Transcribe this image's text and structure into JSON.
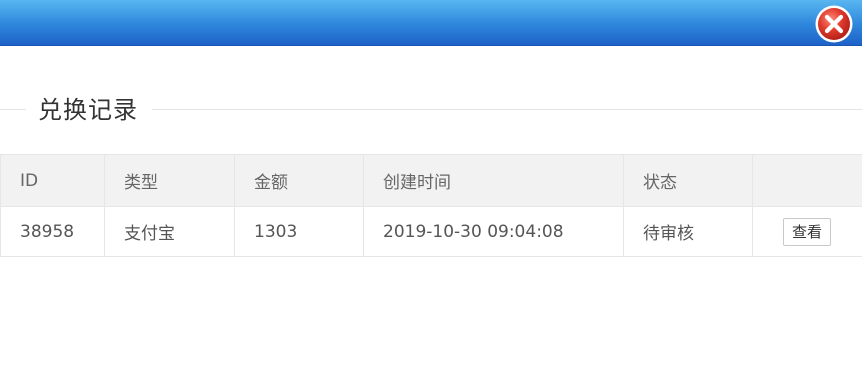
{
  "dialog": {
    "close_icon": "close-icon",
    "close_color": "#d9322b"
  },
  "section": {
    "title": "兑换记录"
  },
  "table": {
    "columns": [
      "ID",
      "类型",
      "金额",
      "创建时间",
      "状态",
      ""
    ],
    "rows": [
      {
        "id": "38958",
        "type": "支付宝",
        "amount": "1303",
        "created_at": "2019-10-30 09:04:08",
        "status": "待审核",
        "action_label": "查看"
      }
    ]
  }
}
